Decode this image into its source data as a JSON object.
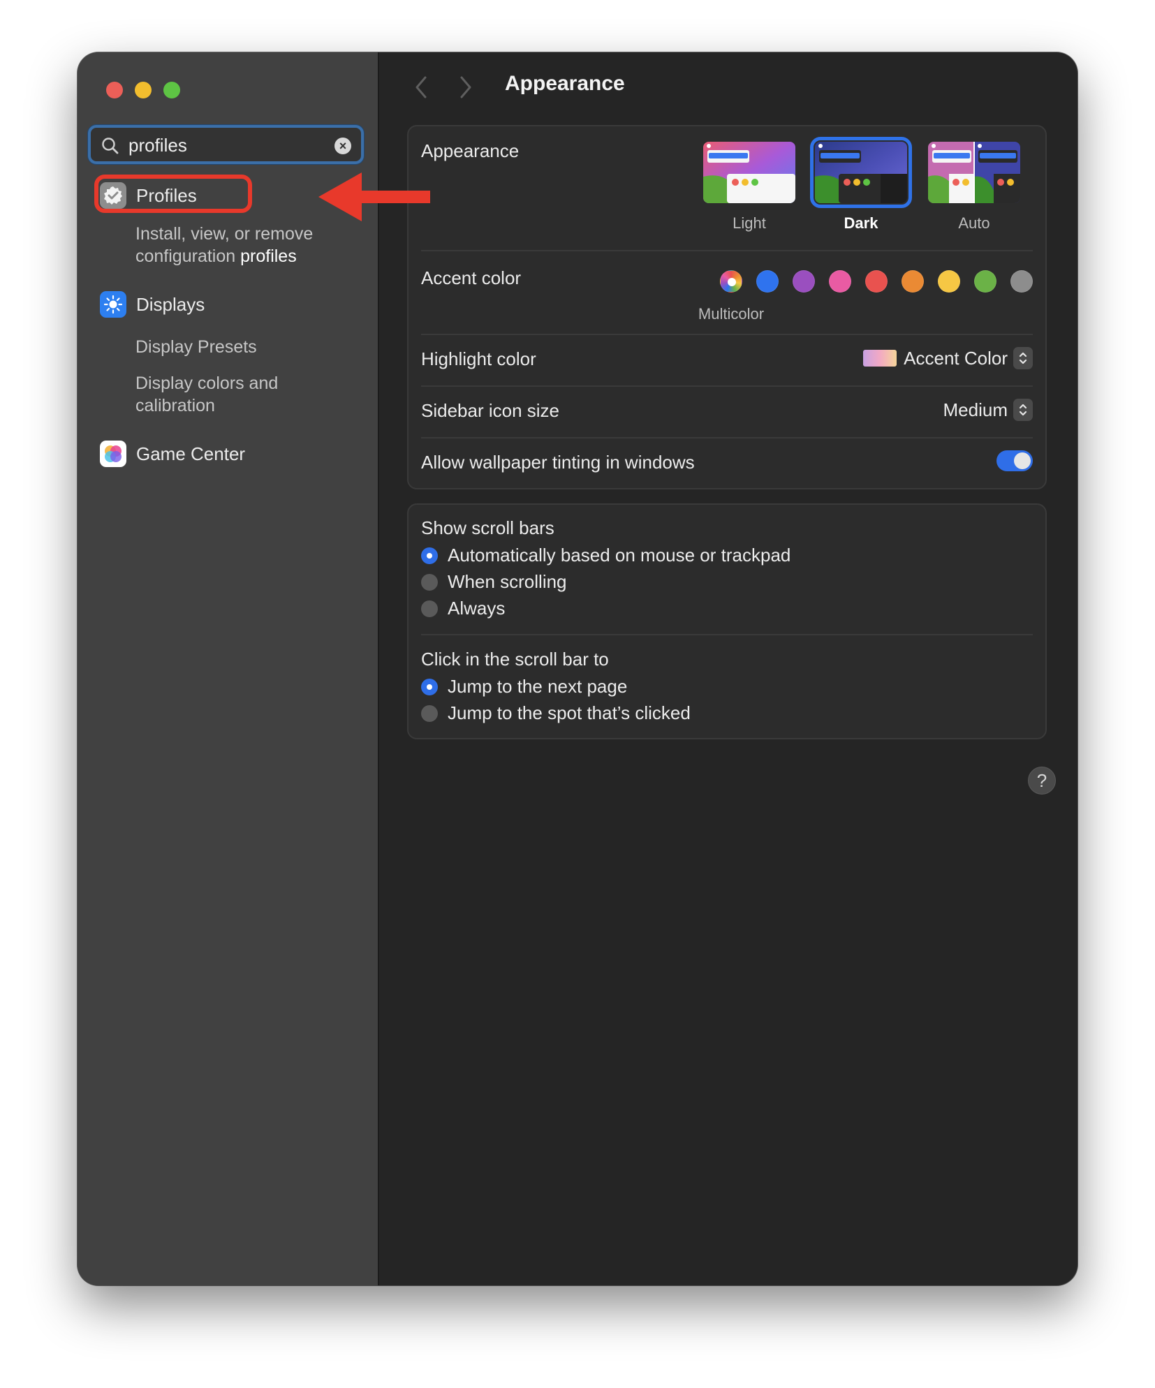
{
  "window": {
    "title": "Appearance"
  },
  "search": {
    "value": "profiles",
    "placeholder": "Search"
  },
  "sidebar": {
    "profiles": {
      "label": "Profiles",
      "description_prefix": "Install, view, or remove configuration",
      "description_match": "profiles"
    },
    "displays": {
      "label": "Displays",
      "sub_items": [
        "Display Presets",
        "Display colors and calibration"
      ]
    },
    "game_center": {
      "label": "Game Center"
    }
  },
  "appearance": {
    "label": "Appearance",
    "options": [
      "Light",
      "Dark",
      "Auto"
    ],
    "selected": "Dark"
  },
  "accent": {
    "label": "Accent color",
    "selected_name": "Multicolor",
    "colors": [
      "multicolor",
      "#2f73ee",
      "#9a4fbf",
      "#e95ba3",
      "#e9524f",
      "#ea8a34",
      "#f6c744",
      "#6bb247",
      "#8d8d8d"
    ]
  },
  "highlight": {
    "label": "Highlight color",
    "value": "Accent Color"
  },
  "sidebar_icon_size": {
    "label": "Sidebar icon size",
    "value": "Medium"
  },
  "wallpaper_tinting": {
    "label": "Allow wallpaper tinting in windows",
    "enabled": true
  },
  "scroll_bars": {
    "label": "Show scroll bars",
    "options": [
      "Automatically based on mouse or trackpad",
      "When scrolling",
      "Always"
    ],
    "selected": "Automatically based on mouse or trackpad"
  },
  "click_scroll": {
    "label": "Click in the scroll bar to",
    "options": [
      "Jump to the next page",
      "Jump to the spot that’s clicked"
    ],
    "selected": "Jump to the next page"
  },
  "help": {
    "label": "?"
  }
}
